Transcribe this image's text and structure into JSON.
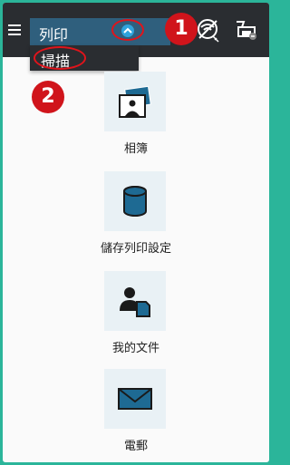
{
  "header": {
    "mode_label": "列印",
    "annotation_1": "1",
    "annotation_2": "2"
  },
  "dropdown": {
    "items": [
      "掃描"
    ]
  },
  "menu": [
    {
      "label": "相簿",
      "icon": "photo-album-icon"
    },
    {
      "label": "儲存列印設定",
      "icon": "storage-icon"
    },
    {
      "label": "我的文件",
      "icon": "my-documents-icon"
    },
    {
      "label": "電郵",
      "icon": "email-icon"
    }
  ],
  "colors": {
    "accent": "#2bb59a",
    "header_bg": "#2a2d31",
    "mode_select_bg": "#2f5f7d",
    "chevron": "#2fa3dc",
    "annotation_red": "#d0141b",
    "icon_blue": "#1e6a93",
    "tile_bg": "#e9f1f5"
  }
}
